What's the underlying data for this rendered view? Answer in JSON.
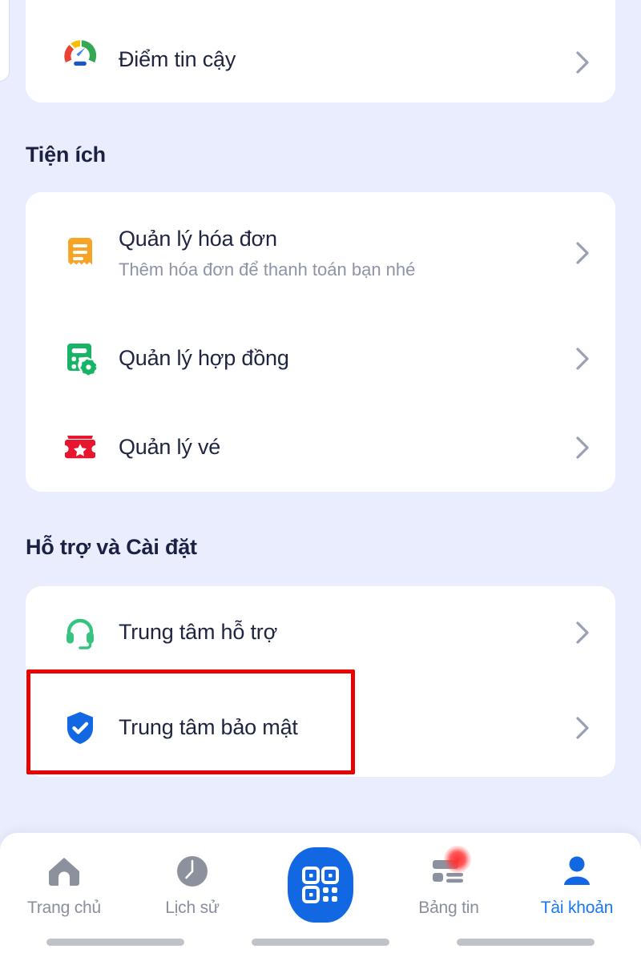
{
  "background_color": "#e9edfd",
  "card_color": "#ffffff",
  "accent_color": "#1877f2",
  "highlight_color": "#e90000",
  "top_card": {
    "items": [
      {
        "icon": "trust-gauge-icon",
        "title": "Điểm tin cậy",
        "chevron": "chevron-right-icon"
      }
    ]
  },
  "sections": [
    {
      "heading": "Tiện ích",
      "items": [
        {
          "icon": "invoice-icon",
          "icon_color": "#f6a326",
          "title": "Quản lý hóa đơn",
          "subtitle": "Thêm hóa đơn để thanh toán bạn nhé",
          "chevron": "chevron-right-icon"
        },
        {
          "icon": "contract-icon",
          "icon_color": "#17b468",
          "title": "Quản lý hợp đồng",
          "subtitle": "",
          "chevron": "chevron-right-icon"
        },
        {
          "icon": "ticket-icon",
          "icon_color": "#e8152e",
          "title": "Quản lý vé",
          "subtitle": "",
          "chevron": "chevron-right-icon"
        }
      ]
    },
    {
      "heading": "Hỗ trợ và Cài đặt",
      "items": [
        {
          "icon": "headset-icon",
          "icon_color": "#35c47f",
          "title": "Trung tâm hỗ trợ",
          "subtitle": "",
          "chevron": "chevron-right-icon"
        },
        {
          "icon": "shield-check-icon",
          "icon_color": "#1268e3",
          "title": "Trung tâm bảo mật",
          "subtitle": "",
          "chevron": "chevron-right-icon",
          "highlighted": true
        }
      ]
    }
  ],
  "bottom_nav": {
    "items": [
      {
        "icon": "home-icon",
        "label": "Trang chủ",
        "active": false
      },
      {
        "icon": "clock-history-icon",
        "label": "Lịch sử",
        "active": false
      },
      {
        "icon": "qr-scan-icon",
        "label": "",
        "active": false
      },
      {
        "icon": "news-feed-icon",
        "label": "Bảng tin",
        "active": false,
        "badge": true
      },
      {
        "icon": "account-person-icon",
        "label": "Tài khoản",
        "active": true
      }
    ]
  }
}
